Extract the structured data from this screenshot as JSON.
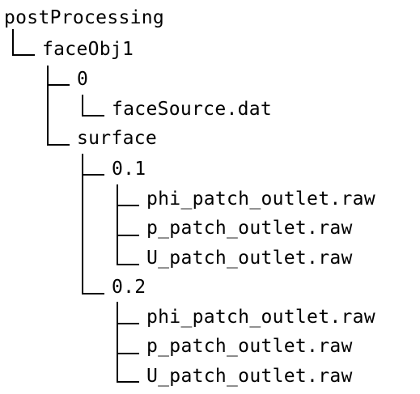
{
  "tree": {
    "root": "postProcessing",
    "nodes": [
      {
        "label": "faceObj1"
      },
      {
        "label": "0"
      },
      {
        "label": "faceSource.dat"
      },
      {
        "label": "surface"
      },
      {
        "label": "0.1"
      },
      {
        "label": "phi_patch_outlet.raw"
      },
      {
        "label": "p_patch_outlet.raw"
      },
      {
        "label": "U_patch_outlet.raw"
      },
      {
        "label": "0.2"
      },
      {
        "label": "phi_patch_outlet.raw"
      },
      {
        "label": "p_patch_outlet.raw"
      },
      {
        "label": "U_patch_outlet.raw"
      }
    ]
  }
}
